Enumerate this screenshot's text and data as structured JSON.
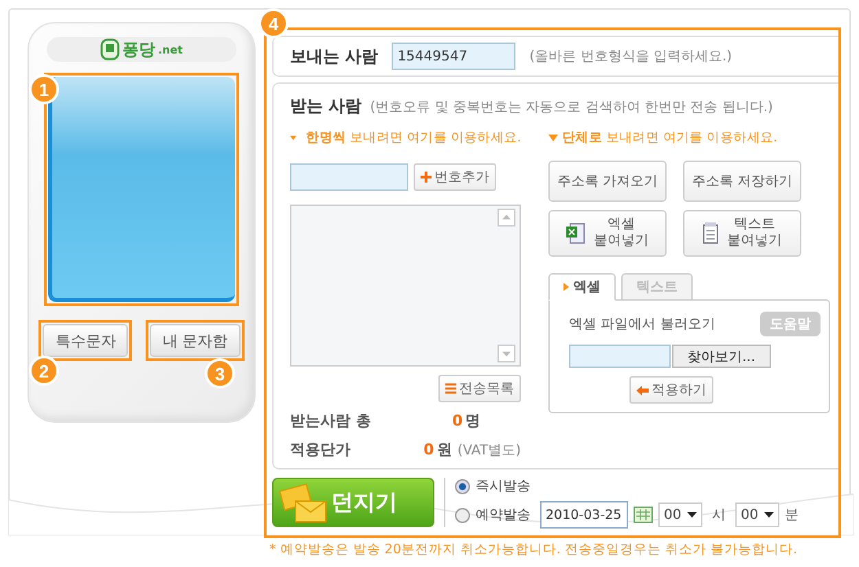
{
  "callouts": [
    "1",
    "2",
    "3",
    "4"
  ],
  "phone": {
    "logo": "퐁당",
    "logo_suffix": ".net",
    "buttons": [
      "특수문자",
      "내 문자함"
    ]
  },
  "sender": {
    "label": "보내는 사람",
    "value": "15449547",
    "hint": "(올바른 번호형식을 입력하세요.)"
  },
  "recipients": {
    "label": "받는 사람",
    "note": "(번호오류 및 중복번호는 자동으로 검색하여 한번만 전송 됩니다.)",
    "single": {
      "hint": "**한명씩** 보내려면 여기를 이용하세요.",
      "add_button": "번호추가",
      "list_button": "전송목록"
    },
    "summary": [
      {
        "label": "받는사람 총",
        "value": "0",
        "unit": "명"
      },
      {
        "label": "적용단가",
        "value": "0",
        "unit": "원",
        "note": "(VAT별도)"
      }
    ],
    "group": {
      "hint": "**단체로** 보내려면 여기를 이용하세요.",
      "buttons": [
        "주소록 가져오기",
        "주소록 저장하기"
      ],
      "paste_buttons": [
        {
          "kind": "excel",
          "lines": [
            "엑셀",
            "붙여넣기"
          ]
        },
        {
          "kind": "text",
          "lines": [
            "텍스트",
            "붙여넣기"
          ]
        }
      ],
      "tabs": [
        {
          "label": "엑셀",
          "selected": true
        },
        {
          "label": "텍스트",
          "selected": false
        }
      ],
      "import_label": "엑셀 파일에서 불러오기",
      "help_button": "도움말",
      "browse_button": "찾아보기...",
      "apply_button": "적용하기"
    }
  },
  "send": {
    "button": "던지기",
    "options": [
      {
        "label": "즉시발송",
        "selected": true
      },
      {
        "label": "예약발송",
        "selected": false
      }
    ],
    "date": "2010-03-25",
    "hour": "00",
    "hour_unit": "시",
    "minute": "00",
    "minute_unit": "분"
  },
  "footnote": "* 예약발송은 발송 20분전까지 취소가능합니다. 전송중일경우는 취소가 불가능합니다."
}
